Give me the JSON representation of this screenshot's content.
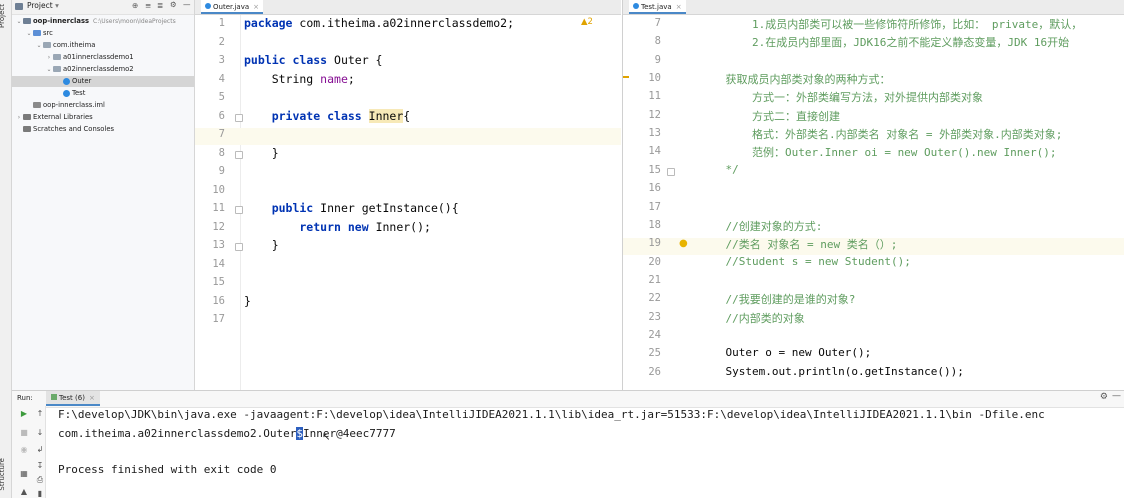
{
  "side_stripe": {
    "project_label": "Project",
    "structure_label": "Structure"
  },
  "project_panel": {
    "title": "Project",
    "tree": [
      {
        "label": "oop-innerclass",
        "path": "C:\\Users\\moon\\IdeaProjects",
        "indent": 0,
        "toggle": "v",
        "icon": "module-folder"
      },
      {
        "label": "src",
        "path": "",
        "indent": 1,
        "toggle": "v",
        "icon": "source-folder"
      },
      {
        "label": "com.itheima",
        "path": "",
        "indent": 2,
        "toggle": "v",
        "icon": "package-folder"
      },
      {
        "label": "a01innerclassdemo1",
        "path": "",
        "indent": 3,
        "toggle": ">",
        "icon": "package-folder"
      },
      {
        "label": "a02innerclassdemo2",
        "path": "",
        "indent": 3,
        "toggle": "v",
        "icon": "package-folder"
      },
      {
        "label": "Outer",
        "path": "",
        "indent": 4,
        "toggle": "",
        "icon": "class",
        "selected": true
      },
      {
        "label": "Test",
        "path": "",
        "indent": 4,
        "toggle": "",
        "icon": "class-main"
      },
      {
        "label": "oop-innerclass.iml",
        "path": "",
        "indent": 1,
        "toggle": "",
        "icon": "iml-file"
      },
      {
        "label": "External Libraries",
        "path": "",
        "indent": 0,
        "toggle": ">",
        "icon": "library"
      },
      {
        "label": "Scratches and Consoles",
        "path": "",
        "indent": 0,
        "toggle": "",
        "icon": "scratches"
      }
    ]
  },
  "left_editor": {
    "tab": "Outer.java",
    "warnings": "▲2",
    "line_numbers": [
      "1",
      "2",
      "3",
      "4",
      "5",
      "6",
      "7",
      "8",
      "9",
      "10",
      "11",
      "12",
      "13",
      "14",
      "15",
      "16",
      "17"
    ],
    "lines": {
      "l1": [
        "package ",
        "com.itheima.a02innerclassdemo2;"
      ],
      "l3": [
        "public ",
        "class ",
        "Outer {"
      ],
      "l4": [
        "    String ",
        "name",
        ";"
      ],
      "l6": [
        "    private ",
        "class ",
        "Inner",
        "{"
      ],
      "l8": [
        "    }"
      ],
      "l11": [
        "    public ",
        "Inner getInstance(){"
      ],
      "l12": [
        "        return ",
        "new ",
        "Inner();"
      ],
      "l13": [
        "    }"
      ],
      "l16": [
        "}"
      ]
    }
  },
  "right_editor": {
    "tab": "Test.java",
    "line_numbers": [
      "7",
      "8",
      "9",
      "10",
      "11",
      "12",
      "13",
      "14",
      "15",
      "16",
      "17",
      "18",
      "19",
      "20",
      "21",
      "22",
      "23",
      "24",
      "25",
      "26"
    ],
    "lines": [
      "        1.成员内部类可以被一些修饰符所修饰，比如： private，默认，",
      "        2.在成员内部里面，JDK16之前不能定义静态变量，JDK 16开始",
      "",
      "    获取成员内部类对象的两种方式：",
      "        方式一：外部类编写方法，对外提供内部类对象",
      "        方式二：直接创建",
      "        格式：外部类名.内部类名 对象名 = 外部类对象.内部类对象;",
      "        范例：Outer.Inner oi = new Outer().new Inner();",
      "    */",
      "",
      "",
      "    //创建对象的方式:",
      "    //类名 对象名 = new 类名（）;",
      "    //Student s = new Student();",
      "",
      "    //我要创建的是谁的对象?",
      "    //内部类的对象",
      "",
      "    Outer o = new Outer();",
      "    System.out.println(o.getInstance());"
    ]
  },
  "run_panel": {
    "label": "Run:",
    "tab": "Test (6)",
    "console": {
      "cmd": "F:\\develop\\JDK\\bin\\java.exe -javaagent:F:\\develop\\idea\\IntelliJIDEA2021.1.1\\lib\\idea_rt.jar=51533:F:\\develop\\idea\\IntelliJIDEA2021.1.1\\bin -Dfile.enc",
      "out_prefix": "com.itheima.a02innerclassdemo2.Outer",
      "out_sel": "$",
      "out_suffix": "Inner@4eec7777",
      "exit": "Process finished with exit code 0"
    }
  },
  "colors": {
    "keyword": "#0033b3",
    "field": "#871094",
    "comment": "#5e9c5e",
    "selection": "#2d5fbf",
    "current_line": "#fcfaed"
  }
}
